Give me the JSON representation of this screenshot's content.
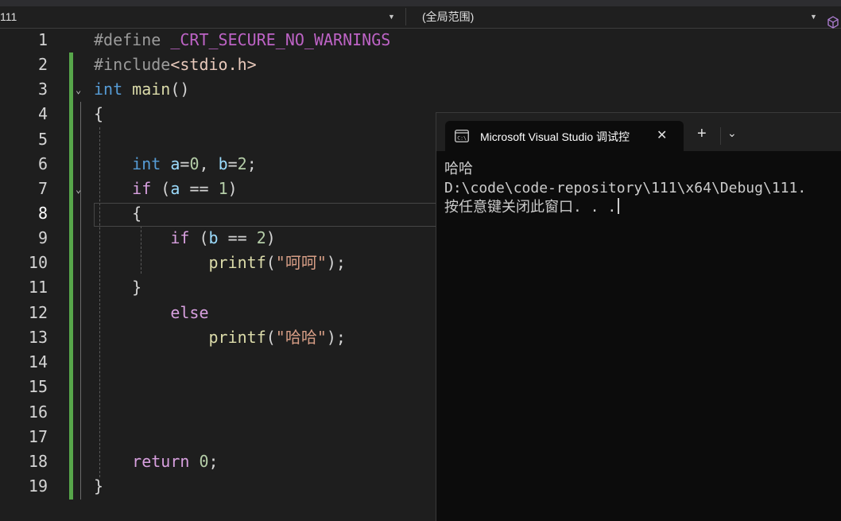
{
  "navbar": {
    "project": "111",
    "scope": "(全局范围)"
  },
  "editor": {
    "line_numbers": [
      "1",
      "2",
      "3",
      "4",
      "5",
      "6",
      "7",
      "8",
      "9",
      "10",
      "11",
      "12",
      "13",
      "14",
      "15",
      "16",
      "17",
      "18",
      "19"
    ],
    "current_line": "8",
    "code": {
      "l1_directive": "#define",
      "l1_macro": "_CRT_SECURE_NO_WARNINGS",
      "l2_directive": "#include",
      "l2_header": "<stdio.h>",
      "l3_type": "int",
      "l3_name": "main",
      "l3_parens": "()",
      "l4": "{",
      "l6_type": "int",
      "l6_a": "a",
      "l6_eq1": "=",
      "l6_zero": "0",
      "l6_comma": ", ",
      "l6_b": "b",
      "l6_eq2": "=",
      "l6_two": "2",
      "l6_semi": ";",
      "l7_if": "if",
      "l7_open": " (",
      "l7_a": "a",
      "l7_op": " == ",
      "l7_one": "1",
      "l7_close": ")",
      "l8": "{",
      "l9_if": "if",
      "l9_open": " (",
      "l9_b": "b",
      "l9_op": " == ",
      "l9_two": "2",
      "l9_close": ")",
      "l10_fn": "printf",
      "l10_open": "(",
      "l10_str": "\"呵呵\"",
      "l10_close": ");",
      "l11": "}",
      "l12_else": "else",
      "l13_fn": "printf",
      "l13_open": "(",
      "l13_str": "\"哈哈\"",
      "l13_close": ");",
      "l18_return": "return",
      "l18_zero": " 0",
      "l18_semi": ";",
      "l19": "}"
    }
  },
  "terminal": {
    "tab_title": "Microsoft Visual Studio 调试控",
    "tab_close": "✕",
    "new_tab": "+",
    "dropdown": "⌄",
    "output": [
      "哈哈",
      "D:\\code\\code-repository\\111\\x64\\Debug\\111.",
      "按任意键关闭此窗口. . ."
    ]
  },
  "colors": {
    "background": "#1e1e1e",
    "change_bar": "#57a64a",
    "keyword": "#569cd6",
    "control": "#d8a0df",
    "function": "#dcdcaa",
    "variable": "#9cdcfe",
    "number": "#b5cea8",
    "string": "#d69d85",
    "macro": "#bd63c5",
    "terminal_bg": "#0c0c0c"
  }
}
